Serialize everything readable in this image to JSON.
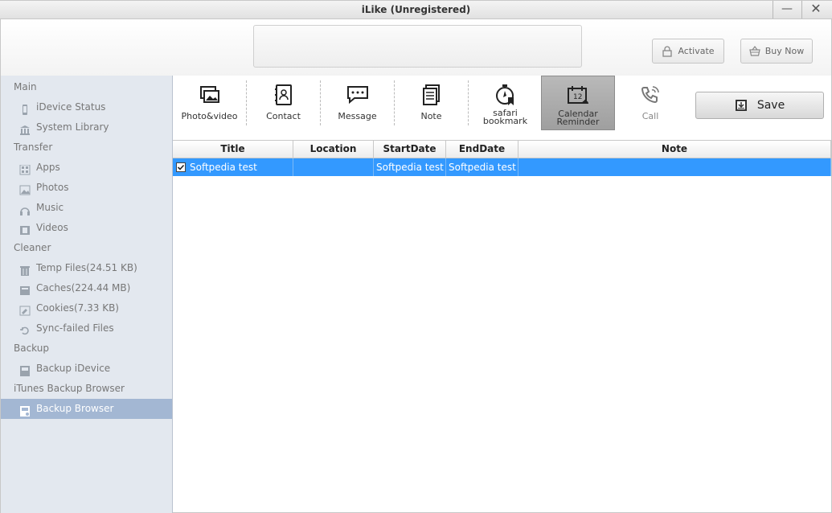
{
  "window": {
    "title": "iLike (Unregistered)",
    "minimize": "—",
    "close": "✕"
  },
  "header": {
    "activate_label": "Activate",
    "buy_label": "Buy Now"
  },
  "sidebar": {
    "sections": [
      {
        "label": "Main",
        "items": [
          {
            "label": "iDevice Status",
            "icon": "phone-icon"
          },
          {
            "label": "System Library",
            "icon": "library-icon"
          }
        ]
      },
      {
        "label": "Transfer",
        "items": [
          {
            "label": "Apps",
            "icon": "apps-icon"
          },
          {
            "label": "Photos",
            "icon": "photos-icon"
          },
          {
            "label": "Music",
            "icon": "headphones-icon"
          },
          {
            "label": "Videos",
            "icon": "film-icon"
          }
        ]
      },
      {
        "label": "Cleaner",
        "items": [
          {
            "label": "Temp Files(24.51 KB)",
            "icon": "trash-icon"
          },
          {
            "label": "Caches(224.44 MB)",
            "icon": "cache-icon"
          },
          {
            "label": "Cookies(7.33 KB)",
            "icon": "cookie-icon"
          },
          {
            "label": "Sync-failed Files",
            "icon": "sync-icon"
          }
        ]
      },
      {
        "label": "Backup",
        "items": [
          {
            "label": "Backup iDevice",
            "icon": "disk-icon"
          }
        ]
      },
      {
        "label": "iTunes Backup Browser",
        "items": [
          {
            "label": "Backup Browser",
            "icon": "browser-icon",
            "active": true
          }
        ]
      }
    ]
  },
  "toolbar": {
    "tools": [
      {
        "label": "Photo&video",
        "icon": "photo-video-icon"
      },
      {
        "label": "Contact",
        "icon": "contact-icon"
      },
      {
        "label": "Message",
        "icon": "message-icon"
      },
      {
        "label": "Note",
        "icon": "note-icon"
      },
      {
        "label": "safari",
        "label2": "bookmark",
        "icon": "safari-bookmark-icon"
      },
      {
        "label": "Calendar",
        "label2": "Reminder",
        "icon": "calendar-icon",
        "active": true
      },
      {
        "label": "Call",
        "icon": "call-icon",
        "disabled": true
      }
    ],
    "save_label": "Save"
  },
  "table": {
    "columns": [
      "Title",
      "Location",
      "StartDate",
      "EndDate",
      "Note"
    ],
    "rows": [
      {
        "checked": true,
        "cells": [
          "Softpedia test",
          "",
          "Softpedia test",
          "Softpedia test",
          ""
        ]
      }
    ]
  },
  "colors": {
    "selection": "#3399ff",
    "sidebar_bg": "#e3e8ef",
    "sidebar_active": "#a3b7d3"
  }
}
